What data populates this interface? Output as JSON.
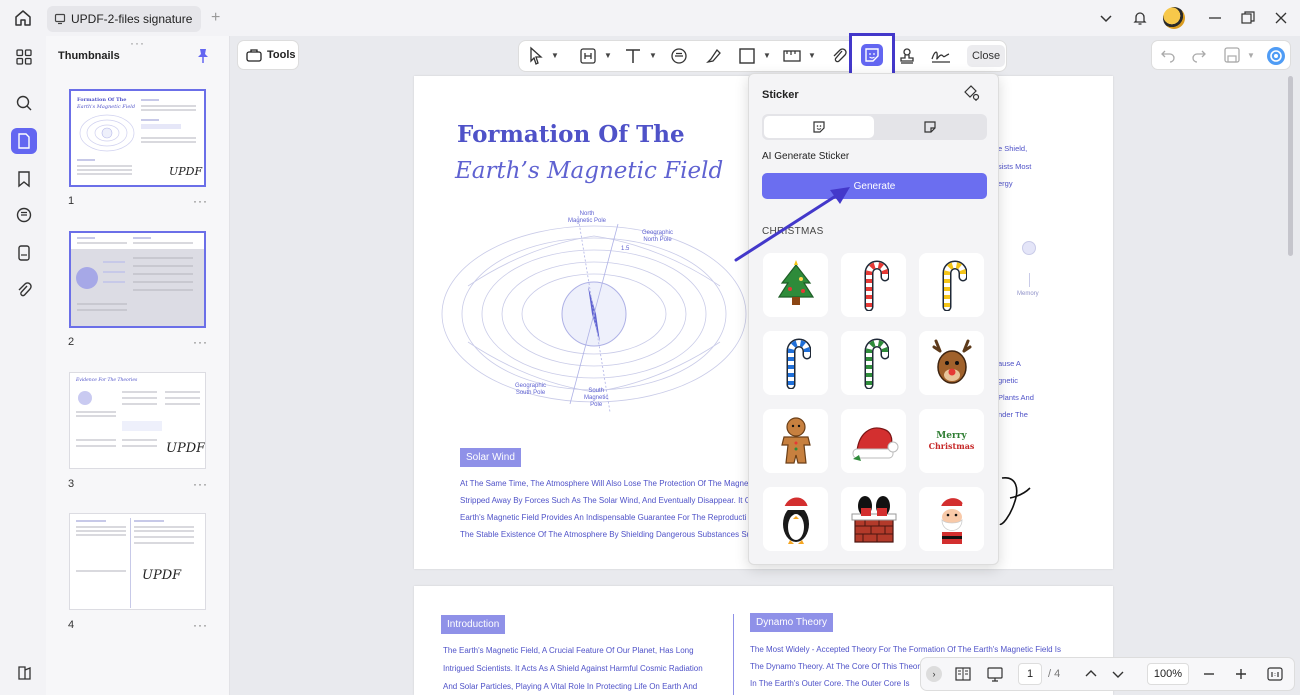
{
  "titlebar": {
    "tab_label": "UPDF-2-files signature"
  },
  "thumbnails": {
    "title": "Thumbnails",
    "pages": [
      {
        "num": "1"
      },
      {
        "num": "2"
      },
      {
        "num": "3"
      },
      {
        "num": "4"
      }
    ],
    "more": "···",
    "page1_sig": "UPDF",
    "page3_title": "Evidence For The Theories",
    "page3_sig": "UPDF",
    "page4_sig": "UPDF",
    "page1_title_a": "Formation Of The",
    "page1_title_b": "Earth's Magnetic Field"
  },
  "toolbar": {
    "tools_label": "Tools",
    "close_label": "Close"
  },
  "page1": {
    "title": "Formation Of The",
    "subtitle": "Earth’s Magnetic Field",
    "diagram": {
      "north_pole": "North\nMagnetic Pole",
      "geo_north": "Geographic\nNorth Pole",
      "geo_south": "Geographic\nSouth Pole",
      "south_pole": "South\nMagnetic\nPole",
      "angle": "1.5"
    },
    "solar_wind": "Solar Wind",
    "solar_lines": [
      "At The Same Time, The Atmosphere Will Also Lose The Protection Of The Magne",
      "Stripped Away By Forces Such As The Solar Wind, And Eventually Disappear. It C",
      "Earth's Magnetic Field Provides An Indispensable Guarantee For The Reproducti",
      "The Stable Existence Of The Atmosphere By Shielding Dangerous Substances Su"
    ],
    "right_frag_top": [
      "e Shield,",
      "sists Most",
      "ergy"
    ],
    "memory": "Memory",
    "right_frag_mid": [
      "ause A",
      "gnetic",
      "Plants And",
      "nder The"
    ]
  },
  "page2": {
    "intro_label": "Introduction",
    "intro_lines": [
      "The Earth's Magnetic Field, A Crucial Feature Of Our Planet, Has Long",
      "Intrigued Scientists. It Acts As A Shield Against Harmful Cosmic Radiation",
      "And Solar Particles, Playing A Vital Role In Protecting Life On Earth And"
    ],
    "dynamo_label": "Dynamo Theory",
    "dynamo_lines": [
      "The Most Widely - Accepted Theory For The Formation Of The Earth's Magnetic Field Is",
      "The Dynamo Theory. At The Core Of This Theor",
      "In The Earth's Outer Core. The Outer Core Is"
    ]
  },
  "sticker_panel": {
    "title": "Sticker",
    "ai_label": "AI Generate Sticker",
    "generate_label": "Generate",
    "category": "CHRISTMAS",
    "stickers": [
      "christmas-tree",
      "candy-cane-red",
      "candy-cane-yellow",
      "candy-cane-blue",
      "candy-cane-green",
      "reindeer",
      "gingerbread-man",
      "santa-hat",
      "merry-christmas-text",
      "penguin",
      "santa-chimney",
      "santa-claus"
    ],
    "merry_text": "Merry",
    "christmas_text": "Christmas"
  },
  "bottom_nav": {
    "page_current": "1",
    "page_total": "/ 4",
    "zoom": "100%"
  },
  "colors": {
    "accent": "#6366f1",
    "highlight_border": "#4338ca",
    "doc_blue": "#4f52c8"
  }
}
